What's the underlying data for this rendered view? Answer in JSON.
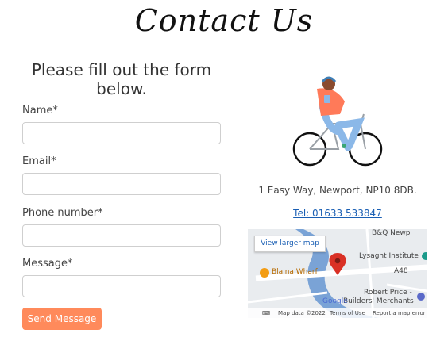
{
  "page": {
    "title": "Contact Us"
  },
  "form": {
    "heading": "Please fill out the form below.",
    "name_label": "Name*",
    "email_label": "Email*",
    "phone_label": "Phone number*",
    "message_label": "Message*",
    "name_value": "",
    "email_value": "",
    "phone_value": "",
    "message_value": "",
    "submit_label": "Send Message"
  },
  "contact": {
    "address": "1 Easy Way, Newport, NP10 8DB.",
    "phone": "Tel: 01633 533847"
  },
  "map": {
    "larger_map_label": "View larger map",
    "label_bq": "B&Q Newp",
    "label_lysaght": "Lysaght Institute",
    "label_blaina": "Blaina Wharf",
    "label_robert": "Robert Price -",
    "label_builders": "Builders' Merchants",
    "label_road": "A48",
    "logo": "Google",
    "footer_data": "Map data ©2022",
    "footer_terms": "Terms of Use",
    "footer_report": "Report a map error"
  },
  "colors": {
    "button": "#ff8a5b",
    "link": "#1a5fb4",
    "river": "#7aa3d6",
    "pin": "#d93025"
  }
}
